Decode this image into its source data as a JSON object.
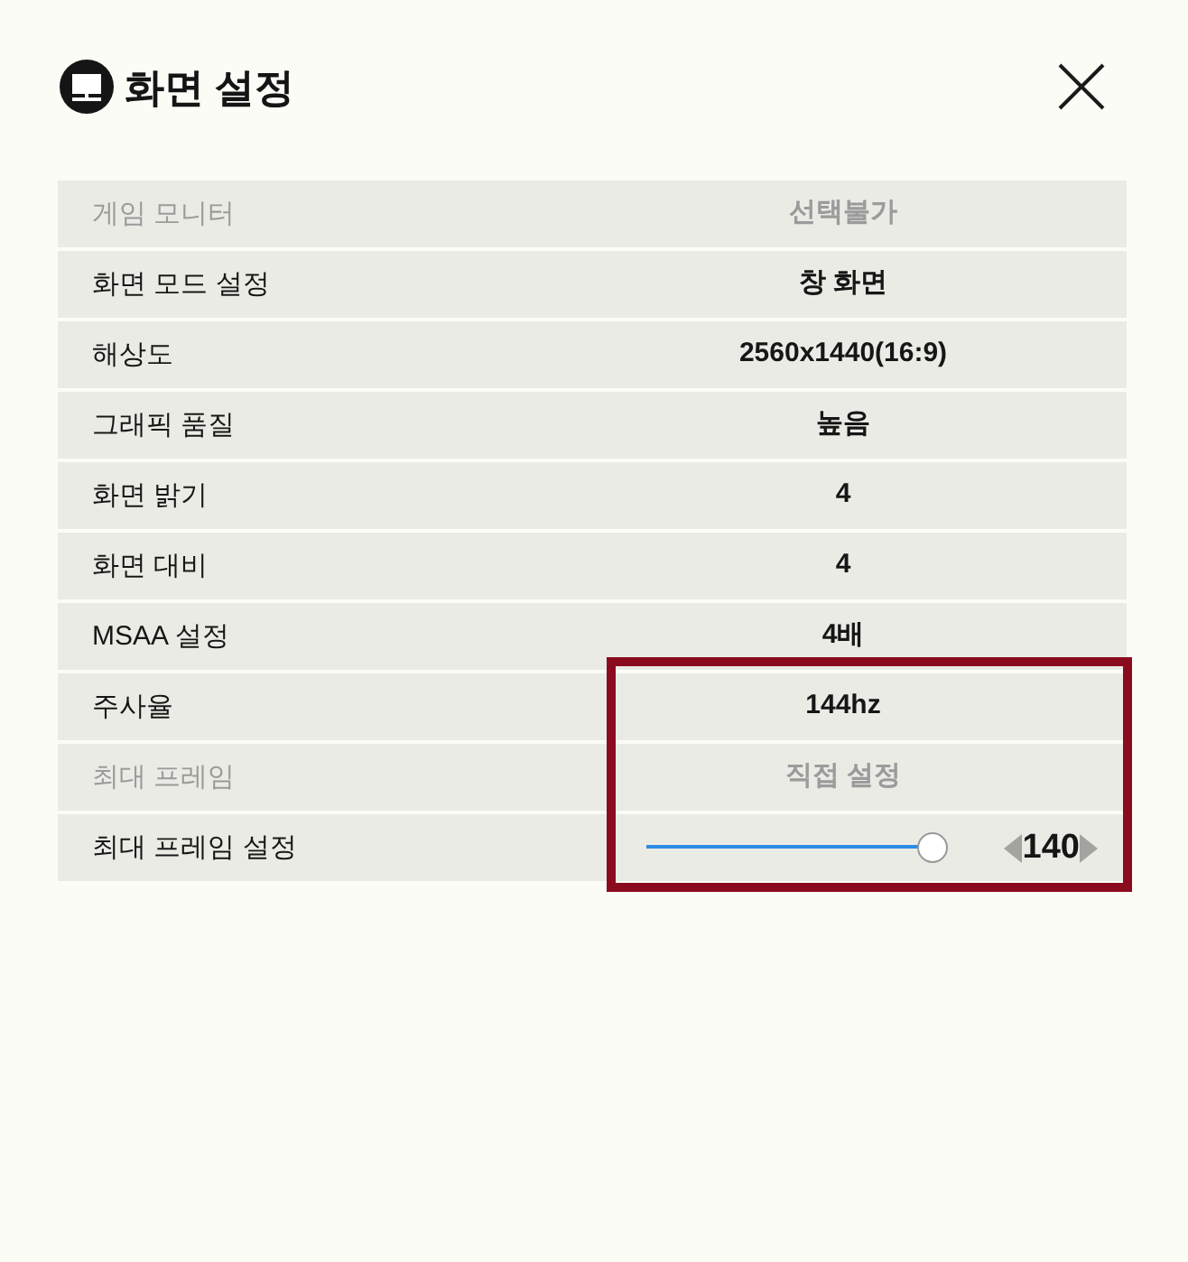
{
  "window": {
    "title": "화면 설정"
  },
  "rows": [
    {
      "label": "게임 모니터",
      "kind": "text",
      "value": "선택불가",
      "disabled": true,
      "highlighted": false
    },
    {
      "label": "화면 모드 설정",
      "kind": "text",
      "value": "창 화면",
      "disabled": false,
      "highlighted": false
    },
    {
      "label": "해상도",
      "kind": "text",
      "value": "2560x1440(16:9)",
      "disabled": false,
      "highlighted": false
    },
    {
      "label": "그래픽 품질",
      "kind": "text",
      "value": "높음",
      "disabled": false,
      "highlighted": false
    },
    {
      "label": "화면 밝기",
      "kind": "text",
      "value": "4",
      "disabled": false,
      "highlighted": false
    },
    {
      "label": "화면 대비",
      "kind": "text",
      "value": "4",
      "disabled": false,
      "highlighted": false
    },
    {
      "label": "MSAA 설정",
      "kind": "text",
      "value": "4배",
      "disabled": false,
      "highlighted": false
    },
    {
      "label": "주사율",
      "kind": "text",
      "value": "144hz",
      "disabled": false,
      "highlighted": true
    },
    {
      "label": "최대 프레임",
      "kind": "text",
      "value": "직접 설정",
      "disabled": true,
      "highlighted": true
    },
    {
      "label": "최대 프레임 설정",
      "kind": "slider",
      "level": 0.95,
      "reading": "140",
      "disabled": false,
      "highlighted": true
    }
  ]
}
